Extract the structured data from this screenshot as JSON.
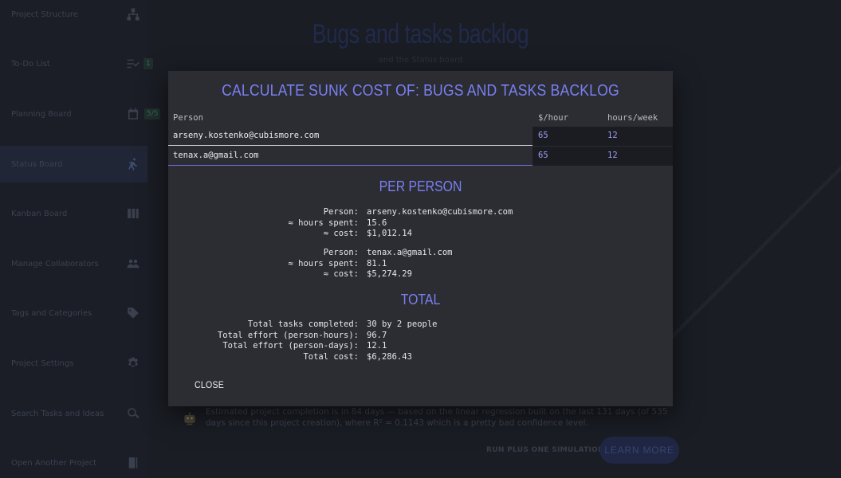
{
  "sidebar": {
    "items": [
      {
        "label": "Project Structure",
        "icon": "hierarchy-icon"
      },
      {
        "label": "To-Do List",
        "icon": "checklist-icon",
        "badge": "1"
      },
      {
        "label": "Planning Board",
        "icon": "calendar-icon",
        "badge": "5/5"
      },
      {
        "label": "Status Board",
        "icon": "runner-icon",
        "active": true
      },
      {
        "label": "Kanban Board",
        "icon": "columns-icon"
      },
      {
        "label": "Manage Collaborators",
        "icon": "people-icon"
      },
      {
        "label": "Tags and Categories",
        "icon": "tag-icon"
      },
      {
        "label": "Project Settings",
        "icon": "gear-icon"
      },
      {
        "label": "Search Tasks and Ideas",
        "icon": "search-icon"
      },
      {
        "label": "Open Another Project",
        "icon": "open-project-icon"
      }
    ]
  },
  "background": {
    "title": "Bugs and tasks backlog",
    "subtitle": "and the Status board",
    "estimate_text": "Estimated project completion is in 84 days — based on the linear regression built on the last 131 days (of 535 days since this project creation), where R² = 0.1143 which is a pretty bad confidence level.",
    "run_simulation_label": "RUN PLUS ONE SIMULATION",
    "learn_more_label": "LEARN MORE"
  },
  "dialog": {
    "title": "CALCULATE SUNK COST OF: BUGS AND TASKS BACKLOG",
    "columns": {
      "person": "Person",
      "rate": "$/hour",
      "hours": "hours/week"
    },
    "rows": [
      {
        "person": "arseny.kostenko@cubismore.com",
        "rate": "65",
        "hours": "12"
      },
      {
        "person": "tenax.a@gmail.com",
        "rate": "65",
        "hours": "12"
      }
    ],
    "per_person_title": "PER PERSON",
    "per_person": [
      {
        "person_label": "Person:",
        "person_value": "arseny.kostenko@cubismore.com",
        "hours_label": "≈ hours spent:",
        "hours_value": "15.6",
        "cost_label": "≈ cost:",
        "cost_value": "$1,012.14"
      },
      {
        "person_label": "Person:",
        "person_value": "tenax.a@gmail.com",
        "hours_label": "≈ hours spent:",
        "hours_value": "81.1",
        "cost_label": "≈ cost:",
        "cost_value": "$5,274.29"
      }
    ],
    "total_title": "TOTAL",
    "totals": [
      {
        "label": "Total tasks completed:",
        "value": "30 by 2 people"
      },
      {
        "label": "Total effort (person-hours):",
        "value": "96.7"
      },
      {
        "label": "Total effort (person-days):",
        "value": "12.1"
      },
      {
        "label": "Total cost:",
        "value": "$6,286.43"
      }
    ],
    "close_label": "CLOSE"
  },
  "colors": {
    "accent": "#7b7ff0",
    "dialog_bg": "#2b2d33",
    "page_bg": "#1a1d24"
  }
}
